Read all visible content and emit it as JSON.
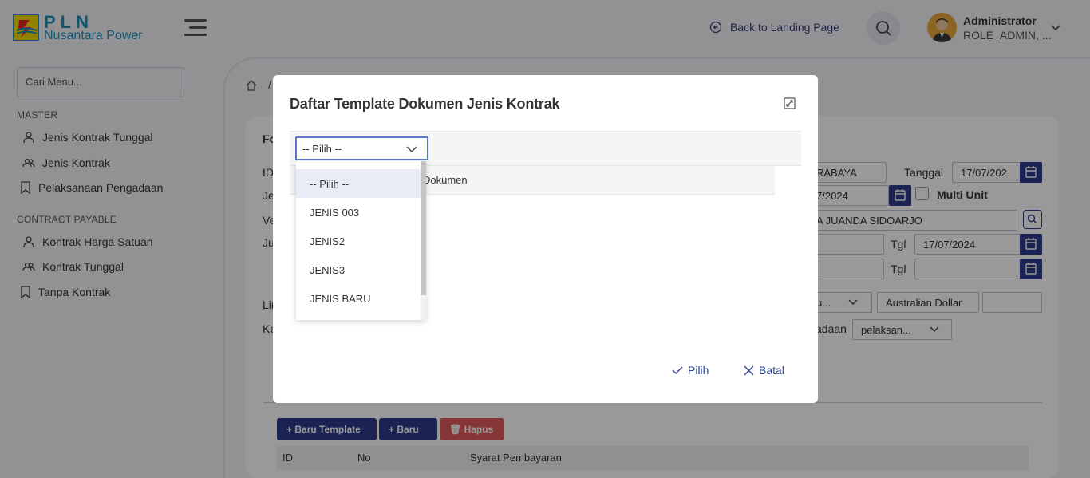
{
  "brand": {
    "title": "PLN",
    "subtitle": "Nusantara Power"
  },
  "header": {
    "back_link": "Back to Landing Page",
    "user_name": "Administrator",
    "user_role": "ROLE_ADMIN, ..."
  },
  "sidebar": {
    "search_placeholder": "Cari Menu...",
    "sections": [
      {
        "title": "MASTER",
        "items": [
          "Jenis Kontrak Tunggal",
          "Jenis Kontrak",
          "Pelaksanaan Pengadaan"
        ]
      },
      {
        "title": "CONTRACT PAYABLE",
        "items": [
          "Kontrak Harga Satuan",
          "Kontrak Tunggal",
          "Tanpa Kontrak"
        ]
      }
    ]
  },
  "background_form": {
    "breadcrumb_sep": "/",
    "form_title_partial": "Fo",
    "left_labels": [
      "ID",
      "Je",
      "Ve",
      "Ju",
      "Lin",
      "Ke"
    ],
    "vendor_city_partial": "RABAYA",
    "tanggal_label": "Tanggal",
    "tanggal_value": "17/07/202",
    "date2_partial": "7/2024",
    "multi_unit_label": "Multi Unit",
    "address_partial": "A JUANDA SIDOARJO",
    "tgl_label": "Tgl",
    "tgl1_value": "17/07/2024",
    "tgl2_value": "",
    "currency_type_partial": "u...",
    "currency": "Australian Dollar",
    "pengadaan_label_partial": "adaan",
    "pengadaan_value": "pelaksan...",
    "buttons": {
      "new_template": "Baru Template",
      "new": "Baru",
      "delete": "Hapus"
    },
    "table_headers": [
      "ID",
      "No",
      "Syarat Pembayaran"
    ]
  },
  "modal": {
    "title": "Daftar Template Dokumen Jenis Kontrak",
    "select_value": "-- Pilih --",
    "column_label_partial": "Dokumen",
    "options": [
      "-- Pilih --",
      "JENIS 003",
      "JENIS2",
      "JENIS3",
      "JENIS BARU"
    ],
    "confirm_label": "Pilih",
    "cancel_label": "Batal"
  },
  "colors": {
    "primary": "#2e3a8c",
    "brand": "#1a8fc0",
    "danger": "#e05a5a"
  }
}
